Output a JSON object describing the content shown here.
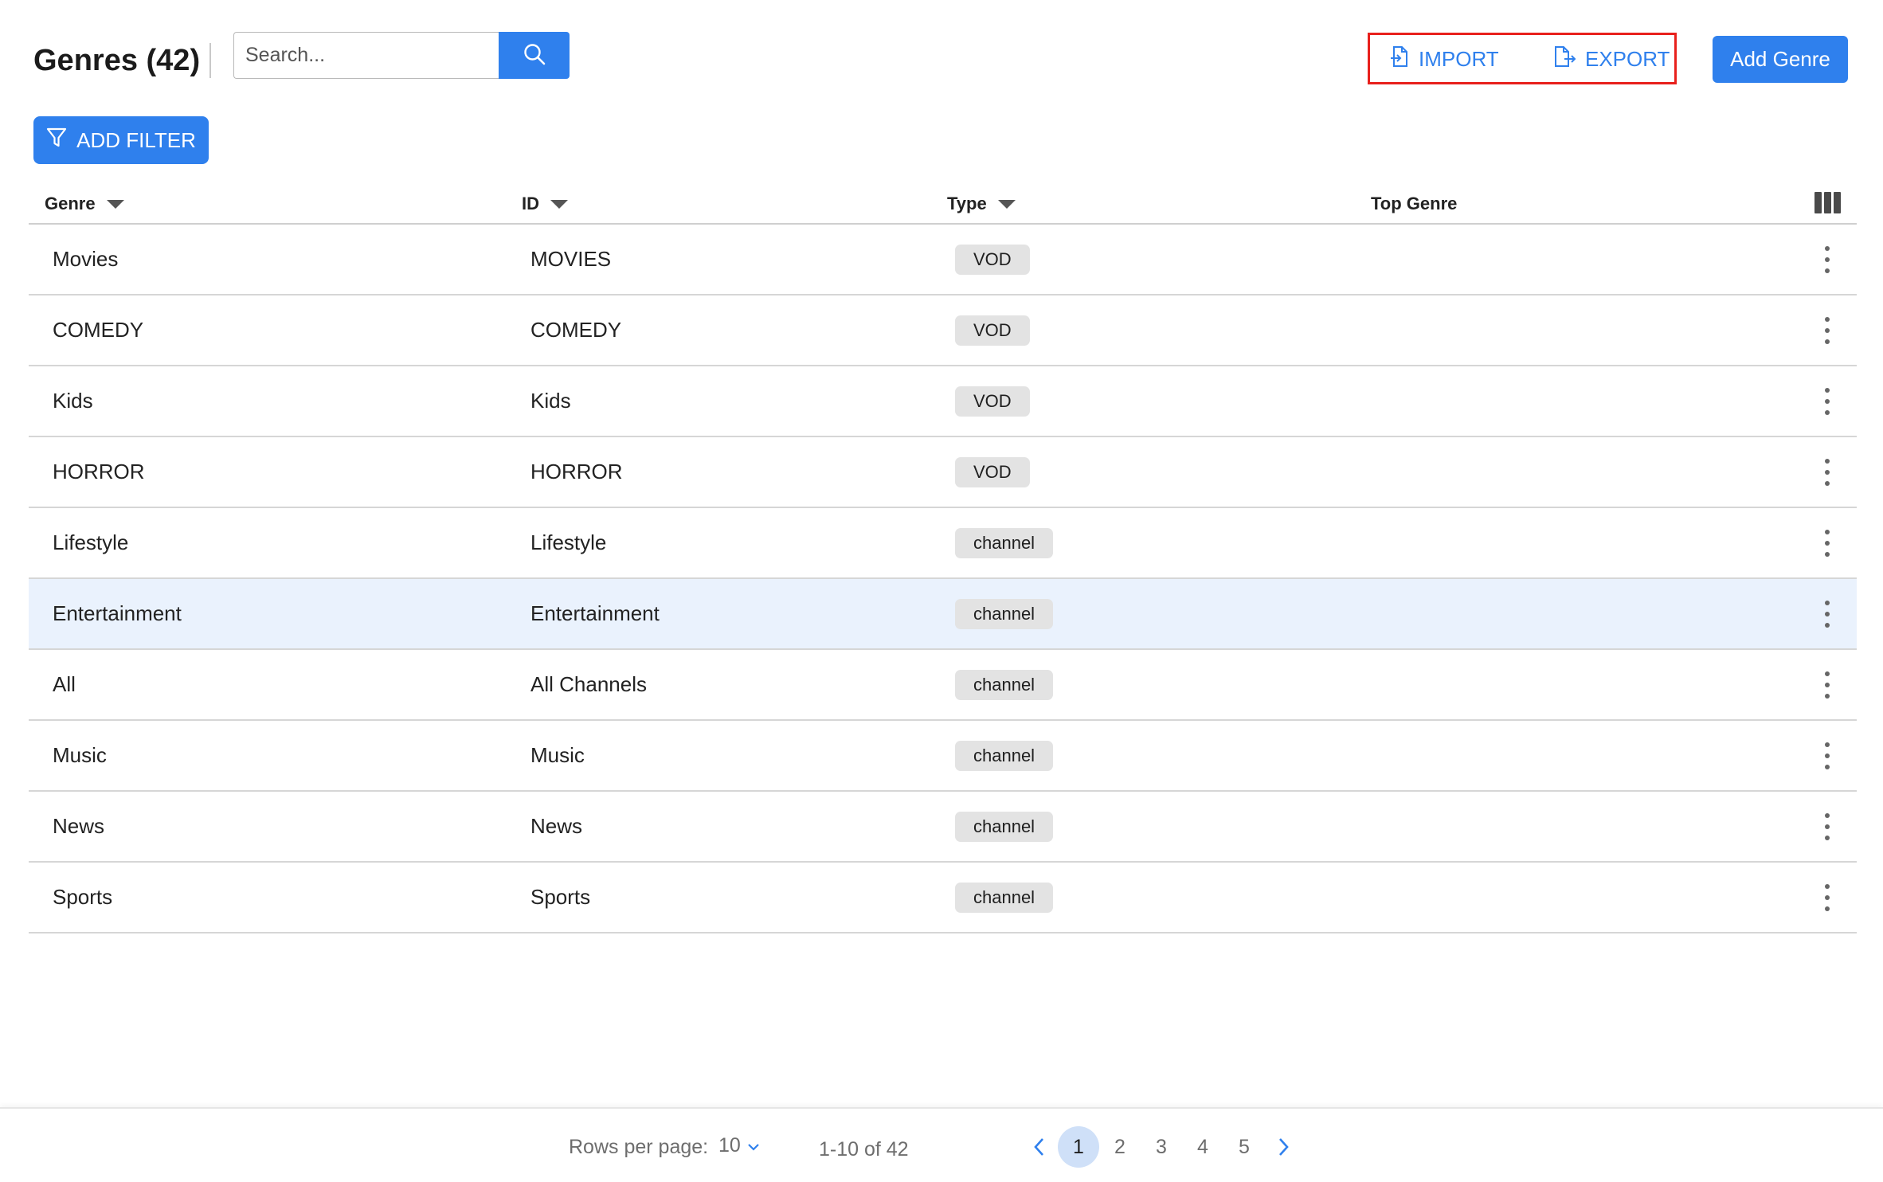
{
  "header": {
    "title": "Genres (42)",
    "search_placeholder": "Search..."
  },
  "actions": {
    "import_label": "IMPORT",
    "export_label": "EXPORT",
    "add_genre_label": "Add Genre"
  },
  "filter": {
    "add_filter_label": "ADD FILTER"
  },
  "table": {
    "columns": {
      "genre": "Genre",
      "id": "ID",
      "type": "Type",
      "top_genre": "Top Genre"
    },
    "rows": [
      {
        "genre": "Movies",
        "id": "MOVIES",
        "type": "VOD"
      },
      {
        "genre": "COMEDY",
        "id": "COMEDY",
        "type": "VOD"
      },
      {
        "genre": "Kids",
        "id": "Kids",
        "type": "VOD"
      },
      {
        "genre": "HORROR",
        "id": "HORROR",
        "type": "VOD"
      },
      {
        "genre": "Lifestyle",
        "id": "Lifestyle",
        "type": "channel"
      },
      {
        "genre": "Entertainment",
        "id": "Entertainment",
        "type": "channel"
      },
      {
        "genre": "All",
        "id": "All Channels",
        "type": "channel"
      },
      {
        "genre": "Music",
        "id": "Music",
        "type": "channel"
      },
      {
        "genre": "News",
        "id": "News",
        "type": "channel"
      },
      {
        "genre": "Sports",
        "id": "Sports",
        "type": "channel"
      }
    ]
  },
  "pagination": {
    "rows_per_page_label": "Rows per page:",
    "rows_per_page_value": "10",
    "range": "1-10 of 42",
    "pages": [
      "1",
      "2",
      "3",
      "4",
      "5"
    ],
    "current_page": "1"
  },
  "colors": {
    "accent": "#2f80ed",
    "highlight": "#e8201c",
    "selected_row": "#eaf2fd",
    "chip": "#e3e3e3"
  },
  "icons": [
    "search-icon",
    "import-icon",
    "export-icon",
    "filter-icon",
    "sort-arrow-icon",
    "columns-icon",
    "more-vert-icon",
    "chevron-down-icon",
    "chevron-left-icon",
    "chevron-right-icon"
  ]
}
